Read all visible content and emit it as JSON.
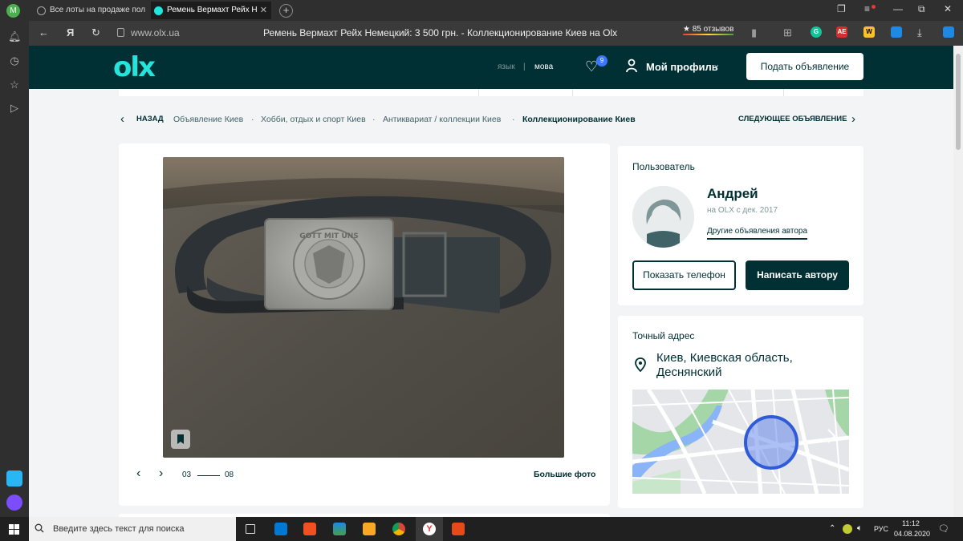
{
  "browser": {
    "profile_letter": "M",
    "tabs": [
      {
        "title": "Все лоты на продаже пол"
      },
      {
        "title": "Ремень Вермахт Рейх Н"
      }
    ],
    "new_tab": "+",
    "address": "www.olx.ua",
    "page_title": "Ремень Вермахт Рейх Немецкий: 3 500 грн. - Коллекционирование Киев на Olx",
    "reviews": "★ 85 отзывов",
    "ya_letter": "Я",
    "ext_icons": [
      {
        "name": "grammarly-icon",
        "label": "G",
        "color": "#15c39a"
      },
      {
        "name": "adguard-icon",
        "label": "AE",
        "color": "#d32f2f"
      },
      {
        "name": "writer-icon",
        "label": "W",
        "color": "#fbc02d"
      },
      {
        "name": "shield-ext-icon",
        "label": "",
        "color": "#1e88e5"
      }
    ]
  },
  "header": {
    "logo": "olx",
    "lang_ru": "язык",
    "lang_sep": "|",
    "lang_ua": "мова",
    "favorites_count": "9",
    "profile_label": "Мой профиль",
    "post_button": "Подать объявление"
  },
  "breadcrumbs": {
    "back": "НАЗАД",
    "items": [
      "Объявление Киев",
      "·",
      "Хобби, отдых и спорт Киев",
      "·",
      "Антиквариат / коллекции Киев",
      "·",
      "Коллекционирование Киев"
    ],
    "next": "СЛЕДУЮЩЕЕ ОБЪЯВЛЕНИЕ"
  },
  "gallery": {
    "current": "03",
    "total": "08",
    "big_photo": "Большие фото",
    "buckle_text": "GOTT MIT UNS"
  },
  "user": {
    "section_title": "Пользователь",
    "name": "Андрей",
    "since": "на OLX с дек. 2017",
    "other_ads": "Другие объявления автора",
    "show_phone": "Показать телефон",
    "write_author": "Написать автору"
  },
  "address": {
    "section_title": "Точный адрес",
    "line1": "Киев, Киевская область,",
    "line2": "Деснянский"
  },
  "taskbar": {
    "search_placeholder": "Введите здесь текст для поиска",
    "lang": "РУС",
    "time": "11:12",
    "date": "04.08.2020"
  }
}
